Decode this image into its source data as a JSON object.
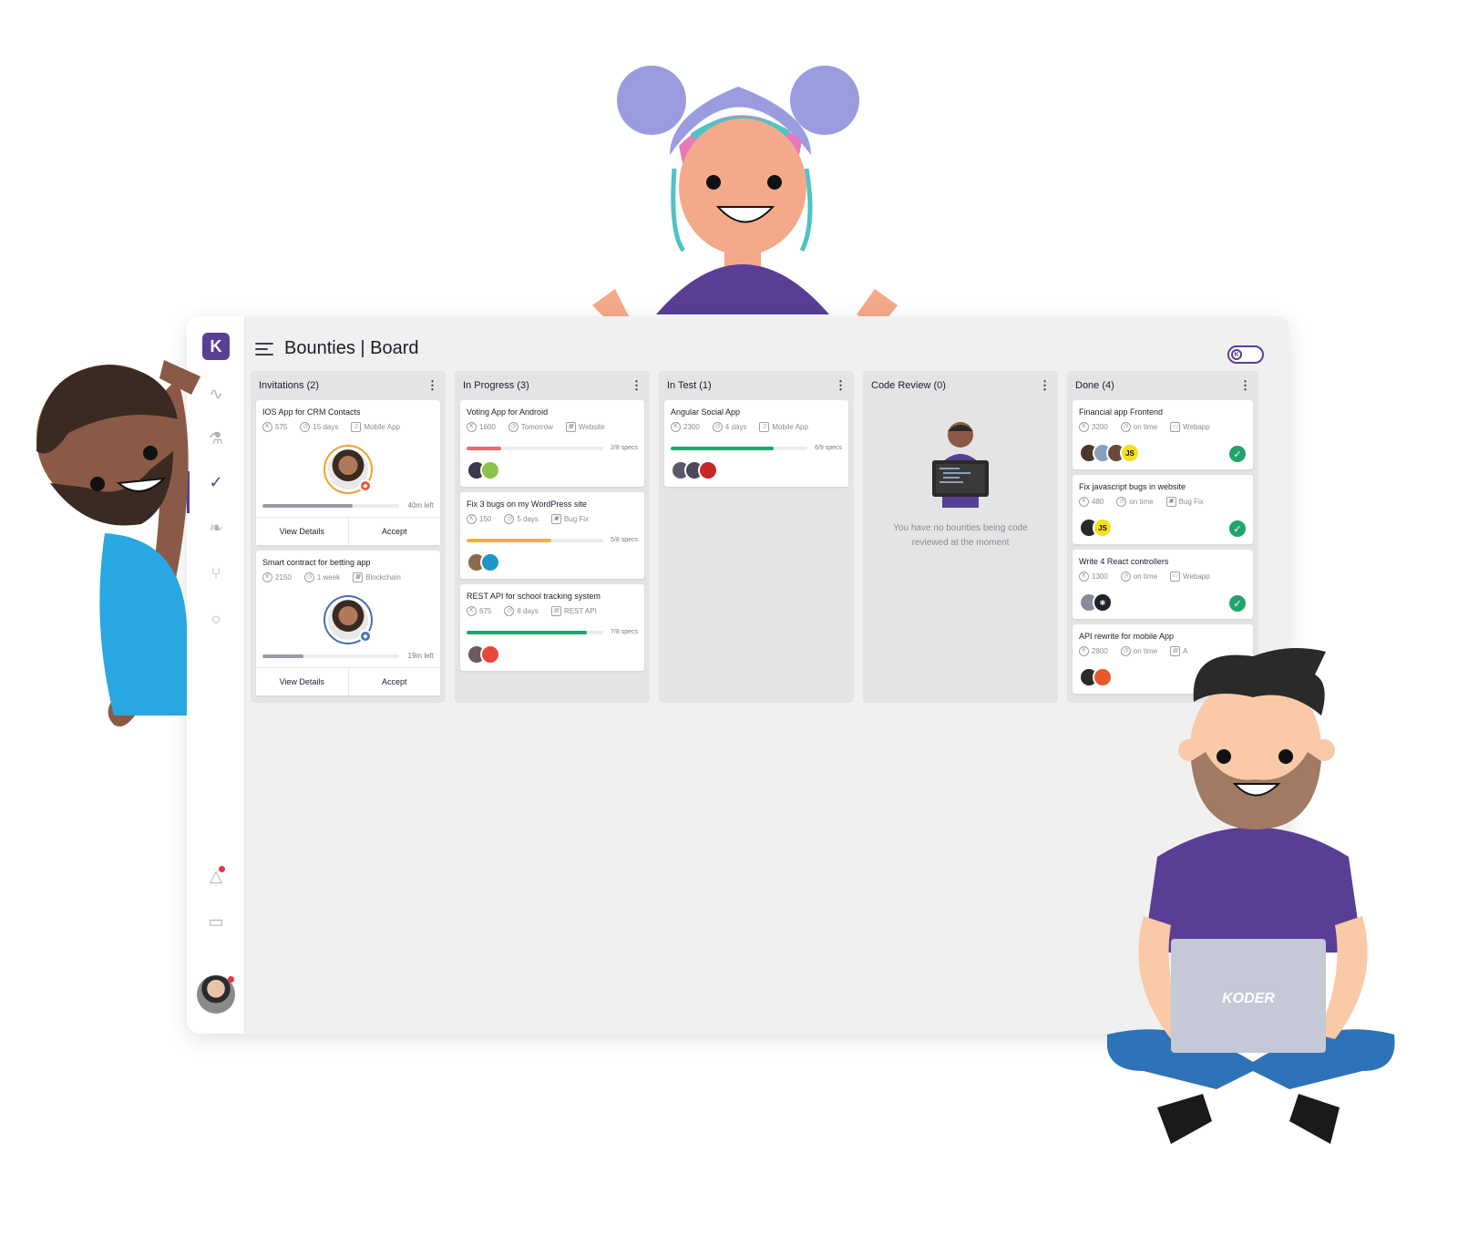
{
  "app": {
    "logo": "K",
    "title": "Bounties | Board"
  },
  "sidebar": {
    "icons": [
      "pulse-icon",
      "lab-flask-icon",
      "check-icon",
      "trophy-icon",
      "git-pull-request-icon",
      "chat-icon",
      "bell-icon",
      "wallet-icon"
    ],
    "active": "check-icon"
  },
  "toggle": {
    "label": "K"
  },
  "columns": [
    {
      "title": "Invitations (2)",
      "cards": [
        {
          "title": "IOS App for CRM Contacts",
          "points": "575",
          "time": "15 days",
          "type": "Mobile App",
          "time_left": "40m left",
          "time_progress": 0.66,
          "ring_color": "#f0a030",
          "badge_color": "#e8562a",
          "actions": [
            "View Details",
            "Accept"
          ]
        },
        {
          "title": "Smart contract for betting app",
          "points": "2150",
          "time": "1 week",
          "type": "Blockchain",
          "time_left": "19m left",
          "time_progress": 0.3,
          "ring_color": "#4a6fb5",
          "badge_color": "#4a6fb5",
          "actions": [
            "View Details",
            "Accept"
          ]
        }
      ]
    },
    {
      "title": "In Progress (3)",
      "cards": [
        {
          "title": "Voting App for Android",
          "points": "1600",
          "time": "Tomorrow",
          "type": "Website",
          "specs": "2/8 specs",
          "progress": 0.25,
          "bar_color": "#e86a6a",
          "avatars": [
            "#3a3a4a",
            "#8bc34a"
          ]
        },
        {
          "title": "Fix 3 bugs on my WordPress site",
          "points": "150",
          "time": "5 days",
          "type": "Bug Fix",
          "specs": "5/8 specs",
          "progress": 0.62,
          "bar_color": "#f0b23a",
          "avatars": [
            "#8a6a4a",
            "#2196c8"
          ]
        },
        {
          "title": "REST API for school tracking system",
          "points": "675",
          "time": "8 days",
          "type": "REST API",
          "specs": "7/8 specs",
          "progress": 0.88,
          "bar_color": "#21a46b",
          "avatars": [
            "#6a5a5a",
            "#e8483a"
          ]
        }
      ]
    },
    {
      "title": "In Test (1)",
      "cards": [
        {
          "title": "Angular Social App",
          "points": "2300",
          "time": "4 days",
          "type": "Mobile App",
          "specs": "6/9 specs",
          "progress": 0.75,
          "bar_color": "#21a46b",
          "avatars": [
            "#5a5a6a",
            "#4a4a5a",
            "#c62828"
          ]
        }
      ]
    },
    {
      "title": "Code Review (0)",
      "empty_text": "You have no bounties being code reviewed at the moment",
      "cards": []
    },
    {
      "title": "Done (4)",
      "cards": [
        {
          "title": "Financial app Frontend",
          "points": "3200",
          "time": "on time",
          "type": "Webapp",
          "avatars": [
            "#4a3a2a",
            "#8aa0b8",
            "#6a4a3a",
            "#f7df1e"
          ],
          "avatar_labels": [
            "",
            "",
            "",
            "JS"
          ]
        },
        {
          "title": "Fix javascript bugs in website",
          "points": "480",
          "time": "on time",
          "type": "Bug Fix",
          "avatars": [
            "#2a2a2a",
            "#f7df1e"
          ],
          "avatar_labels": [
            "",
            "JS"
          ]
        },
        {
          "title": "Write 4 React controllers",
          "points": "1300",
          "time": "on time",
          "type": "Webapp",
          "avatars": [
            "#8a8a9a",
            "#20232a"
          ],
          "avatar_labels": [
            "",
            "⚛"
          ]
        },
        {
          "title": "API rewrite for mobile App",
          "points": "2800",
          "time": "on time",
          "type": "A",
          "avatars": [
            "#2a2a2a",
            "#e8562a"
          ],
          "avatar_labels": [
            "",
            ""
          ]
        }
      ]
    }
  ],
  "laptop_brand": "KODER",
  "colors": {
    "brand": "#5a3e96",
    "success": "#21a46b"
  }
}
